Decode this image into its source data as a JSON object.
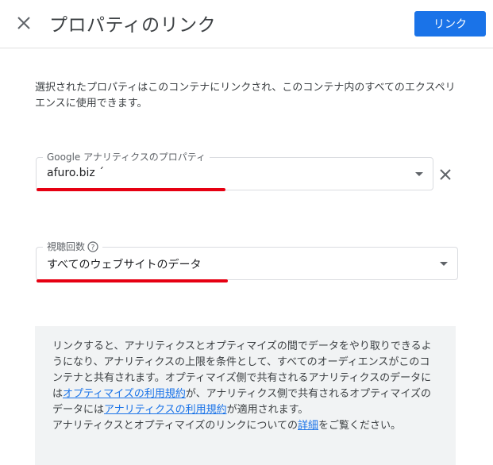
{
  "header": {
    "title": "プロパティのリンク",
    "link_button_label": "リンク"
  },
  "description": "選択されたプロパティはこのコンテナにリンクされ、このコンテナ内のすべてのエクスペリエンスに使用できます。",
  "analytics_property": {
    "label": "Google アナリティクスのプロパティ",
    "value": "afuro.biz ´"
  },
  "view": {
    "label": "視聴回数",
    "value": "すべてのウェブサイトのデータ"
  },
  "info": {
    "text_1": "リンクすると、アナリティクスとオプティマイズの間でデータをやり取りできるようになり、アナリティクスの上限を条件として、すべてのオーディエンスがこのコンテナと共有されます。オプティマイズ側で共有されるアナリティクスのデータには",
    "link_1": "オプティマイズの利用規約",
    "text_2": "が、アナリティクス側で共有されるオプティマイズのデータには",
    "link_2": "アナリティクスの利用規約",
    "text_3": "が適用されます。",
    "text_4": "アナリティクスとオプティマイズのリンクについての",
    "link_3": "詳細",
    "text_5": "をご覧ください。"
  },
  "colors": {
    "primary": "#1a73e8",
    "annotation_red": "#e60012",
    "info_background": "#f1f3f4"
  }
}
